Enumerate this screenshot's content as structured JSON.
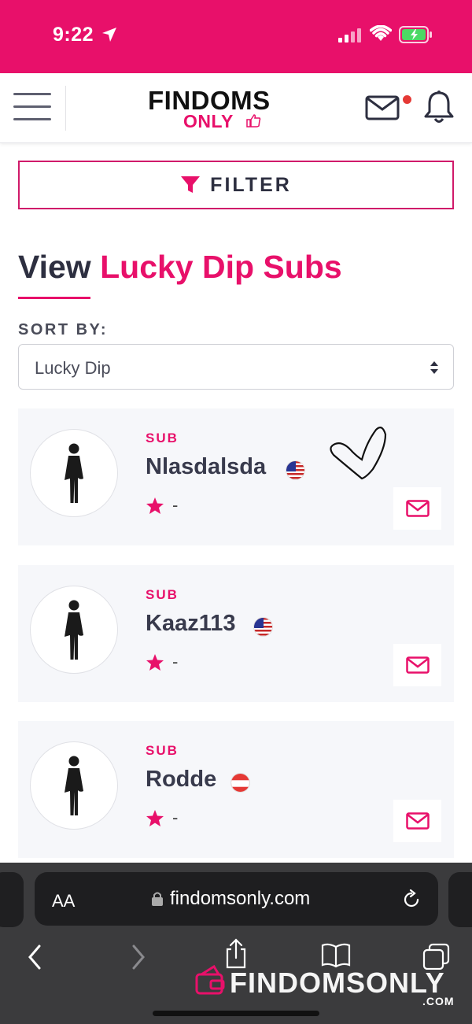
{
  "status_bar": {
    "time": "9:22",
    "bg_color": "#e8106a"
  },
  "header": {
    "logo_top": "FINDOMS",
    "logo_bottom": "ONLY",
    "menu_icon": "hamburger-icon",
    "mail_icon": "mail-icon",
    "bell_icon": "bell-icon",
    "has_unread": true
  },
  "filter": {
    "label": "FILTER",
    "icon": "funnel-icon"
  },
  "page_title": {
    "part1": "View",
    "part2": "Lucky Dip Subs"
  },
  "sort": {
    "label": "SORT BY:",
    "selected": "Lucky Dip"
  },
  "cards": [
    {
      "role": "SUB",
      "username": "Nlasdalsda",
      "flag": "us",
      "rating": "-"
    },
    {
      "role": "SUB",
      "username": "Kaaz113",
      "flag": "us",
      "rating": "-"
    },
    {
      "role": "SUB",
      "username": "Rodde",
      "flag": "at",
      "rating": "-"
    }
  ],
  "browser": {
    "text_size_label": "AA",
    "url": "findomsonly.com",
    "watermark": "FINDOMSONLY",
    "watermark_suffix": ".COM"
  },
  "colors": {
    "accent": "#e8106a",
    "text_dark": "#2d2f40",
    "card_bg": "#f6f7fa"
  }
}
